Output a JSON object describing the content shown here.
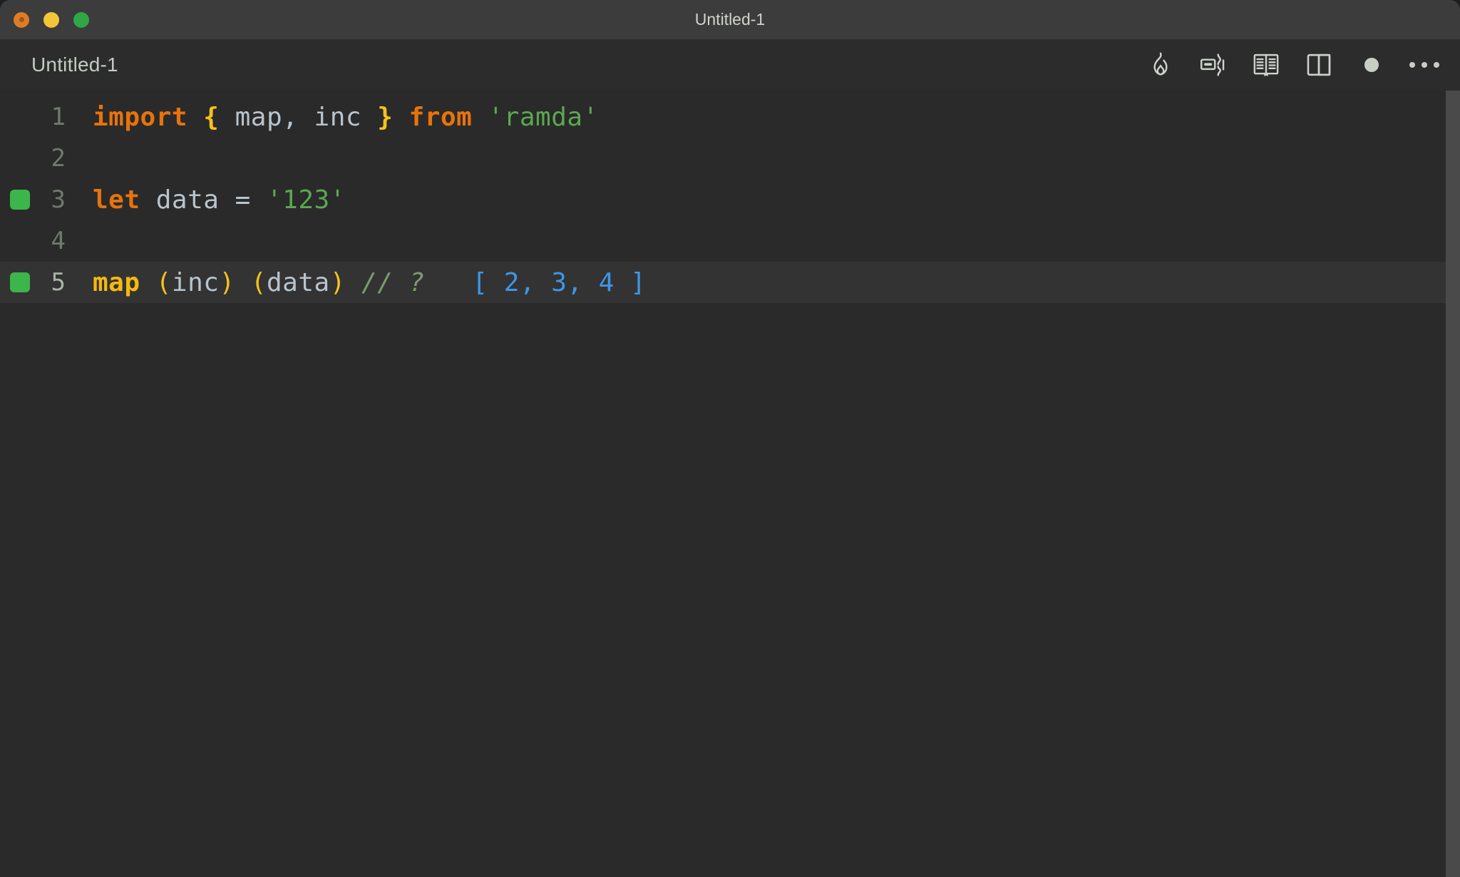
{
  "window": {
    "title": "Untitled-1",
    "traffic_lights": [
      {
        "name": "close",
        "color": "#e07b25"
      },
      {
        "name": "minimize",
        "color": "#f3c63a"
      },
      {
        "name": "maximize",
        "color": "#2fa745"
      }
    ]
  },
  "tab": {
    "label": "Untitled-1"
  },
  "toolbar": {
    "items": [
      {
        "icon": "flame-icon",
        "title": "Quokka"
      },
      {
        "icon": "run-split-icon",
        "title": "Run"
      },
      {
        "icon": "open-book-icon",
        "title": "Open Preview"
      },
      {
        "icon": "split-editor-icon",
        "title": "Split Editor"
      },
      {
        "icon": "unsaved-dot-icon",
        "title": "Unsaved changes"
      },
      {
        "icon": "ellipsis-icon",
        "title": "More Actions"
      }
    ]
  },
  "editor": {
    "language": "javascript",
    "background": "#2a2a2a",
    "active_line": 5,
    "lines": [
      {
        "number": "1",
        "marker": false,
        "tokens": [
          {
            "text": "import",
            "type": "keyword"
          },
          {
            "text": " ",
            "type": "plain"
          },
          {
            "text": "{",
            "type": "brace"
          },
          {
            "text": " ",
            "type": "plain"
          },
          {
            "text": "map",
            "type": "identifier"
          },
          {
            "text": ",",
            "type": "operator"
          },
          {
            "text": " ",
            "type": "plain"
          },
          {
            "text": "inc",
            "type": "identifier"
          },
          {
            "text": " ",
            "type": "plain"
          },
          {
            "text": "}",
            "type": "brace"
          },
          {
            "text": " ",
            "type": "plain"
          },
          {
            "text": "from",
            "type": "keyword"
          },
          {
            "text": " ",
            "type": "plain"
          },
          {
            "text": "'ramda'",
            "type": "string"
          }
        ]
      },
      {
        "number": "2",
        "marker": false,
        "tokens": []
      },
      {
        "number": "3",
        "marker": true,
        "tokens": [
          {
            "text": "let",
            "type": "keyword"
          },
          {
            "text": " ",
            "type": "plain"
          },
          {
            "text": "data",
            "type": "identifier"
          },
          {
            "text": " ",
            "type": "plain"
          },
          {
            "text": "=",
            "type": "operator"
          },
          {
            "text": " ",
            "type": "plain"
          },
          {
            "text": "'123'",
            "type": "string"
          }
        ]
      },
      {
        "number": "4",
        "marker": false,
        "tokens": []
      },
      {
        "number": "5",
        "marker": true,
        "tokens": [
          {
            "text": "map",
            "type": "function"
          },
          {
            "text": " ",
            "type": "plain"
          },
          {
            "text": "(",
            "type": "paren"
          },
          {
            "text": "inc",
            "type": "identifier"
          },
          {
            "text": ")",
            "type": "paren"
          },
          {
            "text": " ",
            "type": "plain"
          },
          {
            "text": "(",
            "type": "paren"
          },
          {
            "text": "data",
            "type": "identifier"
          },
          {
            "text": ")",
            "type": "paren"
          },
          {
            "text": " ",
            "type": "plain"
          },
          {
            "text": "//",
            "type": "comment"
          },
          {
            "text": " ",
            "type": "plain"
          },
          {
            "text": "?",
            "type": "comment"
          },
          {
            "text": "   ",
            "type": "plain"
          },
          {
            "text": "[ 2, 3, 4 ]",
            "type": "result"
          }
        ]
      }
    ]
  },
  "colors": {
    "keyword": "#e8730c",
    "brace": "#f5c21b",
    "identifier": "#b8c4cc",
    "string": "#5aa84f",
    "function": "#f5b90f",
    "comment": "#7d9b6e",
    "result": "#3d97e8",
    "marker_green": "#3cb54a",
    "editor_bg": "#2a2a2a",
    "titlebar_bg": "#3c3c3c",
    "active_line_bg": "#333333"
  }
}
